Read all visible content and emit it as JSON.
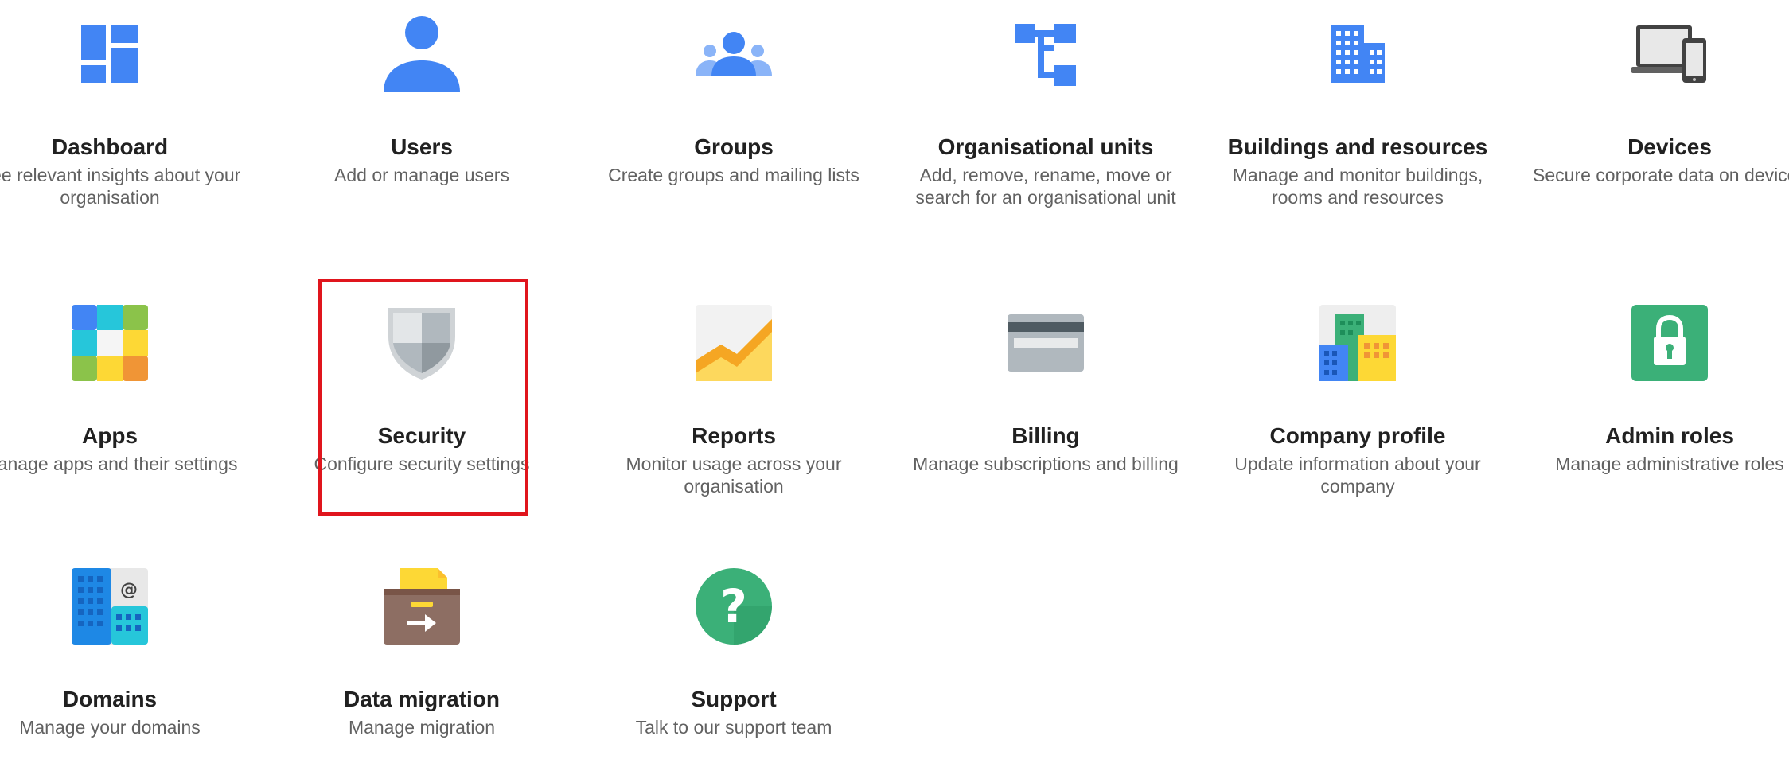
{
  "tiles": [
    {
      "key": "dashboard",
      "title": "Dashboard",
      "description": "See relevant insights about your organisation",
      "icon": "dashboard-icon"
    },
    {
      "key": "users",
      "title": "Users",
      "description": "Add or manage users",
      "icon": "user-icon"
    },
    {
      "key": "groups",
      "title": "Groups",
      "description": "Create groups and mailing lists",
      "icon": "groups-icon"
    },
    {
      "key": "org-units",
      "title": "Organisational units",
      "description": "Add, remove, rename, move or search for an organisational unit",
      "icon": "org-units-icon"
    },
    {
      "key": "buildings",
      "title": "Buildings and resources",
      "description": "Manage and monitor buildings, rooms and resources",
      "icon": "building-icon"
    },
    {
      "key": "devices",
      "title": "Devices",
      "description": "Secure corporate data on devices",
      "icon": "devices-icon"
    },
    {
      "key": "apps",
      "title": "Apps",
      "description": "Manage apps and their settings",
      "icon": "apps-icon"
    },
    {
      "key": "security",
      "title": "Security",
      "description": "Configure security settings",
      "icon": "shield-icon"
    },
    {
      "key": "reports",
      "title": "Reports",
      "description": "Monitor usage across your organisation",
      "icon": "reports-chart-icon"
    },
    {
      "key": "billing",
      "title": "Billing",
      "description": "Manage subscriptions and billing",
      "icon": "credit-card-icon"
    },
    {
      "key": "company-profile",
      "title": "Company profile",
      "description": "Update information about your company",
      "icon": "company-buildings-icon"
    },
    {
      "key": "admin-roles",
      "title": "Admin roles",
      "description": "Manage administrative roles",
      "icon": "lock-icon"
    },
    {
      "key": "domains",
      "title": "Domains",
      "description": "Manage your domains",
      "icon": "domains-icon"
    },
    {
      "key": "data-migration",
      "title": "Data migration",
      "description": "Manage migration",
      "icon": "migration-box-icon"
    },
    {
      "key": "support",
      "title": "Support",
      "description": "Talk to our support team",
      "icon": "help-icon"
    }
  ],
  "selected_tile": "security",
  "colors": {
    "selection_border": "#e0151d",
    "blue": "#4285f4",
    "green": "#3bb078",
    "title_text": "#212121",
    "description_text": "#616161"
  }
}
